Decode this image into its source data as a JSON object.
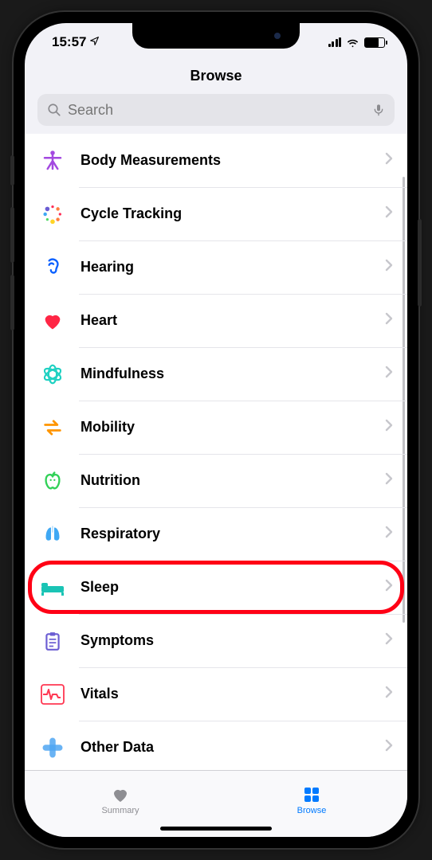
{
  "status": {
    "time": "15:57"
  },
  "header": {
    "title": "Browse"
  },
  "search": {
    "placeholder": "Search"
  },
  "categories": [
    {
      "id": "body-measurements",
      "label": "Body Measurements",
      "icon": "body-icon",
      "color": "#a349e0"
    },
    {
      "id": "cycle-tracking",
      "label": "Cycle Tracking",
      "icon": "cycle-icon",
      "color": "#ff2d55"
    },
    {
      "id": "hearing",
      "label": "Hearing",
      "icon": "ear-icon",
      "color": "#0a60ff"
    },
    {
      "id": "heart",
      "label": "Heart",
      "icon": "heart-icon",
      "color": "#ff2645"
    },
    {
      "id": "mindfulness",
      "label": "Mindfulness",
      "icon": "mindfulness-icon",
      "color": "#1fd1c2"
    },
    {
      "id": "mobility",
      "label": "Mobility",
      "icon": "mobility-icon",
      "color": "#ff9500"
    },
    {
      "id": "nutrition",
      "label": "Nutrition",
      "icon": "apple-icon",
      "color": "#32d158"
    },
    {
      "id": "respiratory",
      "label": "Respiratory",
      "icon": "lungs-icon",
      "color": "#3fa8f4"
    },
    {
      "id": "sleep",
      "label": "Sleep",
      "icon": "bed-icon",
      "color": "#1ac4b5",
      "highlighted": true
    },
    {
      "id": "symptoms",
      "label": "Symptoms",
      "icon": "clipboard-icon",
      "color": "#6b5dd3"
    },
    {
      "id": "vitals",
      "label": "Vitals",
      "icon": "vitals-icon",
      "color": "#ff3752"
    },
    {
      "id": "other-data",
      "label": "Other Data",
      "icon": "plus-icon",
      "color": "#4fa6f2"
    }
  ],
  "tabs": {
    "summary": {
      "label": "Summary"
    },
    "browse": {
      "label": "Browse"
    }
  }
}
